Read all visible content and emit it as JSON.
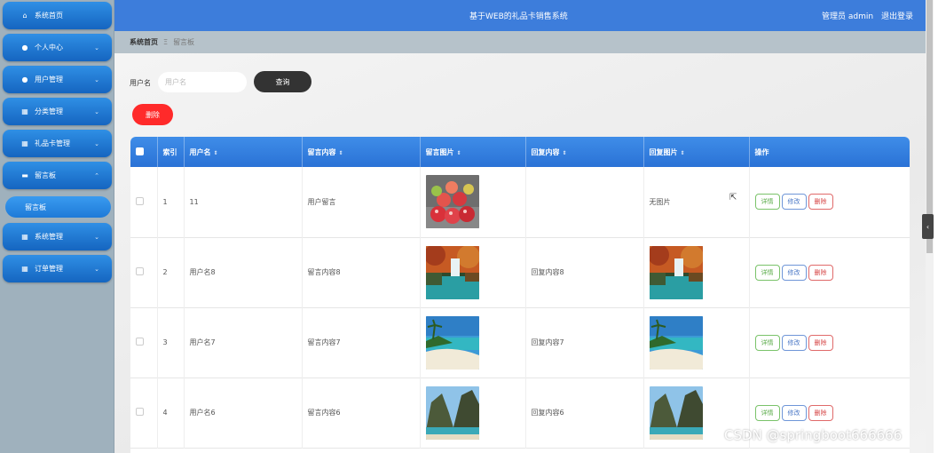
{
  "topbar": {
    "title": "基于WEB的礼品卡销售系统",
    "user_label": "管理员 admin",
    "logout_label": "退出登录"
  },
  "sidebar": {
    "items": [
      {
        "label": "系统首页",
        "icon": "home-icon",
        "chevron": ""
      },
      {
        "label": "个人中心",
        "icon": "person-icon",
        "chevron": "⌄"
      },
      {
        "label": "用户管理",
        "icon": "user-icon",
        "chevron": "⌄"
      },
      {
        "label": "分类管理",
        "icon": "grid-icon",
        "chevron": "⌄"
      },
      {
        "label": "礼品卡管理",
        "icon": "grid-icon",
        "chevron": "⌄"
      },
      {
        "label": "留言板",
        "icon": "message-icon",
        "chevron": "⌃"
      },
      {
        "label": "系统管理",
        "icon": "grid-icon",
        "chevron": "⌄"
      },
      {
        "label": "订单管理",
        "icon": "grid-icon",
        "chevron": "⌄"
      }
    ],
    "submenu_label": "留言板"
  },
  "breadcrumb": {
    "home": "系统首页",
    "separator": "Ξ",
    "current": "留言板"
  },
  "search": {
    "label": "用户名",
    "placeholder": "用户名",
    "button_label": "查询"
  },
  "delete_button_label": "删除",
  "table": {
    "headers": [
      "索引",
      "用户名",
      "留言内容",
      "留言图片",
      "回复内容",
      "回复图片",
      "操作"
    ],
    "sort_glyph": "⇕",
    "rows": [
      {
        "index": "1",
        "username": "11",
        "content": "用户留言",
        "image": "apples",
        "reply": "",
        "reply_image": "",
        "reply_image_text": "无图片"
      },
      {
        "index": "2",
        "username": "用户名8",
        "content": "留言内容8",
        "image": "lake",
        "reply": "回复内容8",
        "reply_image": "lake",
        "reply_image_text": ""
      },
      {
        "index": "3",
        "username": "用户名7",
        "content": "留言内容7",
        "image": "beach",
        "reply": "回复内容7",
        "reply_image": "beach",
        "reply_image_text": ""
      },
      {
        "index": "4",
        "username": "用户名6",
        "content": "留言内容6",
        "image": "cliff",
        "reply": "回复内容6",
        "reply_image": "cliff",
        "reply_image_text": ""
      }
    ],
    "actions": {
      "detail": "详情",
      "edit": "修改",
      "delete": "删除"
    }
  },
  "side_toggle": "‹",
  "watermark": "CSDN @springboot666666",
  "colors": {
    "topbar": "#3d7ddb",
    "menu": "#1e73d0",
    "delete": "#ff2a2a",
    "search_button": "#333333"
  }
}
